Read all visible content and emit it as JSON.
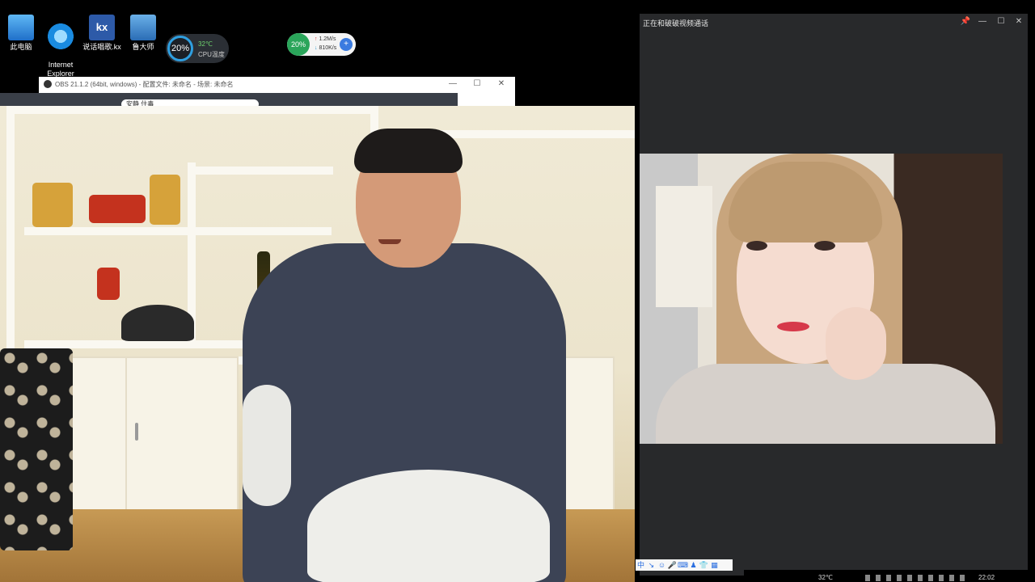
{
  "desktop": {
    "icons": [
      {
        "label": "此电脑"
      },
      {
        "label": "Internet\nExplorer"
      },
      {
        "label": "说话唱歌.kx"
      },
      {
        "label": "鲁大师"
      }
    ]
  },
  "cpu_widget": {
    "percent": "20%",
    "temp": "32℃",
    "label": "CPU温度"
  },
  "net_widget": {
    "percent": "20%",
    "up": "1.2M/s",
    "down": "810K/s"
  },
  "obs": {
    "title": "OBS 21.1.2 (64bit, windows) - 配置文件: 未命名 - 场景: 未命名",
    "controls": {
      "minimize": "—",
      "maximize": "☐",
      "close": "✕"
    }
  },
  "browser": {
    "search_text": "安静 住毒"
  },
  "video_call": {
    "title": "正在和破破视频通话",
    "controls": {
      "pin": "📌",
      "minimize": "—",
      "maximize": "☐",
      "close": "✕"
    },
    "toolbar": [
      "中",
      "↘",
      "☺",
      "🎤",
      "⌨",
      "♟",
      "👕",
      "▦"
    ]
  },
  "taskbar": {
    "temp": "32℃",
    "time": "22:02"
  }
}
